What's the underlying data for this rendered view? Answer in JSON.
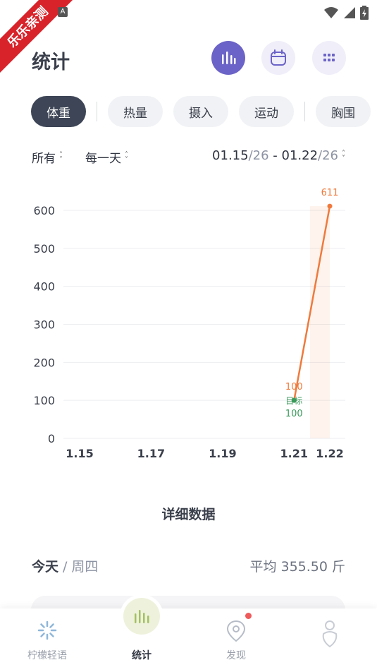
{
  "status_bar": {
    "badge_text": "乐乐亲测",
    "a_icon": "A"
  },
  "header": {
    "title": "统计"
  },
  "tabs": [
    {
      "label": "体重",
      "active": true
    },
    {
      "label": "热量",
      "active": false
    },
    {
      "label": "摄入",
      "active": false
    },
    {
      "label": "运动",
      "active": false
    },
    {
      "label": "胸围",
      "active": false
    }
  ],
  "filters": {
    "scope": "所有",
    "interval": "每一天",
    "date_start": "01.15",
    "year_start": "/26",
    "date_sep": " - ",
    "date_end": "01.22",
    "year_end": "/26"
  },
  "chart_data": {
    "type": "line",
    "x_tick_labels": [
      "1.15",
      "1.17",
      "1.19",
      "1.21",
      "1.22"
    ],
    "x": [
      "1.15",
      "1.16",
      "1.17",
      "1.18",
      "1.19",
      "1.20",
      "1.21",
      "1.22"
    ],
    "ylim": [
      0,
      600
    ],
    "y_ticks": [
      0,
      100,
      200,
      300,
      400,
      500,
      600
    ],
    "grid": true,
    "series": [
      {
        "color": "#ef7a3c",
        "points": [
          {
            "x": "1.21",
            "y": 100
          },
          {
            "x": "1.22",
            "y": 611
          }
        ],
        "point_labels": [
          "100",
          "611"
        ]
      }
    ],
    "marker": {
      "x": "1.21",
      "y": 100,
      "label_top": "目标",
      "label_bottom": "100",
      "color": "#3a9a5b"
    }
  },
  "details": {
    "section_title": "详细数据",
    "today": "今天",
    "slash": "/",
    "weekday": "周四",
    "average": "平均 355.50 斤"
  },
  "bottom_nav": [
    {
      "label": "柠檬轻语",
      "icon": "lemon-icon",
      "active": false
    },
    {
      "label": "统计",
      "icon": "bar-chart-icon",
      "active": true
    },
    {
      "label": "发现",
      "icon": "discover-icon",
      "active": false,
      "badge": true
    },
    {
      "label": "",
      "icon": "profile-icon",
      "active": false
    }
  ],
  "colors": {
    "accent": "#6b63c7",
    "tab_active": "#3d4556",
    "line": "#ef7a3c",
    "goal": "#3a9a5b"
  }
}
